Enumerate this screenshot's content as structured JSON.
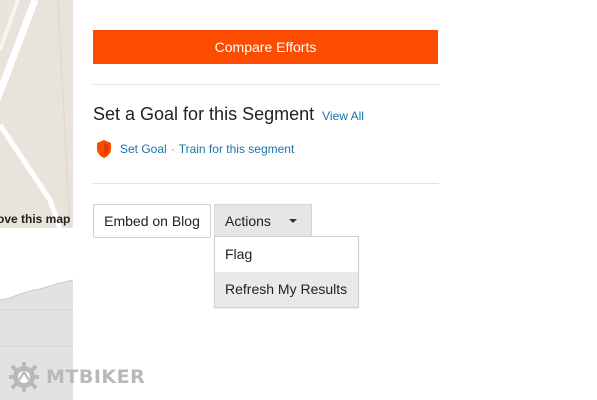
{
  "map": {
    "label": "ove this map"
  },
  "main": {
    "compare_button": "Compare Efforts",
    "goal": {
      "title": "Set a Goal for this Segment",
      "view_all": "View All",
      "set_goal": "Set Goal",
      "separator": "·",
      "train": "Train for this segment"
    },
    "embed_button": "Embed on Blog",
    "actions_button": "Actions",
    "actions_menu": [
      {
        "label": "Flag"
      },
      {
        "label": "Refresh My Results"
      }
    ]
  },
  "watermark": {
    "text": "MTBIKER"
  },
  "colors": {
    "accent": "#fc4c02",
    "link": "#1a73a8",
    "watermark": "#b9b9b9"
  }
}
